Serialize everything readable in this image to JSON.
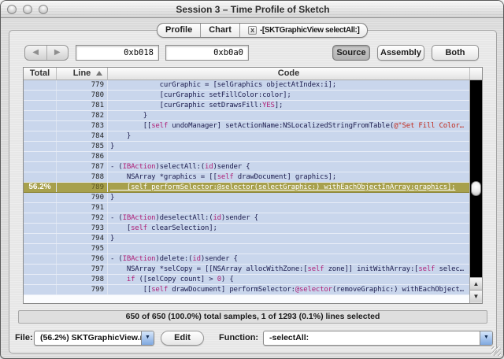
{
  "window": {
    "title": "Session 3 – Time Profile of Sketch"
  },
  "tabs": [
    {
      "label": "Profile"
    },
    {
      "label": "Chart"
    },
    {
      "label": "-[SKTGraphicView selectAll:]",
      "close_icon": "x"
    }
  ],
  "toolbar": {
    "back_icon": "◀",
    "forward_icon": "▶",
    "address1": "0xb018",
    "address2": "0xb0a0",
    "view_buttons": [
      {
        "label": "Source",
        "selected": true
      },
      {
        "label": "Assembly",
        "selected": false
      },
      {
        "label": "Both",
        "selected": false
      }
    ]
  },
  "table": {
    "columns": {
      "total": "Total",
      "line": "Line",
      "code": "Code"
    },
    "sort_column": "Line",
    "rows": [
      {
        "total": "",
        "line": "779",
        "highlight": false,
        "code": [
          {
            "t": "            curGraphic = [selGraphics objectAtIndex:i];",
            "c": "p"
          }
        ]
      },
      {
        "total": "",
        "line": "780",
        "highlight": false,
        "code": [
          {
            "t": "            [curGraphic setFillColor:color];",
            "c": "p"
          }
        ]
      },
      {
        "total": "",
        "line": "781",
        "highlight": false,
        "code": [
          {
            "t": "            [curGraphic setDrawsFill:",
            "c": "p"
          },
          {
            "t": "YES",
            "c": "k"
          },
          {
            "t": "];",
            "c": "p"
          }
        ]
      },
      {
        "total": "",
        "line": "782",
        "highlight": false,
        "code": [
          {
            "t": "        }",
            "c": "p"
          }
        ]
      },
      {
        "total": "",
        "line": "783",
        "highlight": false,
        "code": [
          {
            "t": "        [[",
            "c": "p"
          },
          {
            "t": "self",
            "c": "k"
          },
          {
            "t": " undoManager] setActionName:NSLocalizedStringFromTable(",
            "c": "p"
          },
          {
            "t": "@\"Set Fill Color…",
            "c": "s"
          }
        ]
      },
      {
        "total": "",
        "line": "784",
        "highlight": false,
        "code": [
          {
            "t": "    }",
            "c": "p"
          }
        ]
      },
      {
        "total": "",
        "line": "785",
        "highlight": false,
        "code": [
          {
            "t": "}",
            "c": "p"
          }
        ]
      },
      {
        "total": "",
        "line": "786",
        "highlight": false,
        "code": []
      },
      {
        "total": "",
        "line": "787",
        "highlight": false,
        "code": [
          {
            "t": "- (",
            "c": "p"
          },
          {
            "t": "IBAction",
            "c": "k"
          },
          {
            "t": ")selectAll:(",
            "c": "p"
          },
          {
            "t": "id",
            "c": "k"
          },
          {
            "t": ")sender {",
            "c": "p"
          }
        ]
      },
      {
        "total": "",
        "line": "788",
        "highlight": false,
        "code": [
          {
            "t": "    NSArray *graphics = [[",
            "c": "p"
          },
          {
            "t": "self",
            "c": "k"
          },
          {
            "t": " drawDocument] graphics];",
            "c": "p"
          }
        ]
      },
      {
        "total": "56.2%",
        "line": "789",
        "highlight": true,
        "code": [
          {
            "t": "    [self performSelector:@selector(selectGraphic:) withEachObjectInArray:graphics];",
            "c": "p"
          }
        ]
      },
      {
        "total": "",
        "line": "790",
        "highlight": false,
        "code": [
          {
            "t": "}",
            "c": "p"
          }
        ]
      },
      {
        "total": "",
        "line": "791",
        "highlight": false,
        "code": []
      },
      {
        "total": "",
        "line": "792",
        "highlight": false,
        "code": [
          {
            "t": "- (",
            "c": "p"
          },
          {
            "t": "IBAction",
            "c": "k"
          },
          {
            "t": ")deselectAll:(",
            "c": "p"
          },
          {
            "t": "id",
            "c": "k"
          },
          {
            "t": ")sender {",
            "c": "p"
          }
        ]
      },
      {
        "total": "",
        "line": "793",
        "highlight": false,
        "code": [
          {
            "t": "    [",
            "c": "p"
          },
          {
            "t": "self",
            "c": "k"
          },
          {
            "t": " clearSelection];",
            "c": "p"
          }
        ]
      },
      {
        "total": "",
        "line": "794",
        "highlight": false,
        "code": [
          {
            "t": "}",
            "c": "p"
          }
        ]
      },
      {
        "total": "",
        "line": "795",
        "highlight": false,
        "code": []
      },
      {
        "total": "",
        "line": "796",
        "highlight": false,
        "code": [
          {
            "t": "- (",
            "c": "p"
          },
          {
            "t": "IBAction",
            "c": "k"
          },
          {
            "t": ")delete:(",
            "c": "p"
          },
          {
            "t": "id",
            "c": "k"
          },
          {
            "t": ")sender {",
            "c": "p"
          }
        ]
      },
      {
        "total": "",
        "line": "797",
        "highlight": false,
        "code": [
          {
            "t": "    NSArray *selCopy = [[NSArray allocWithZone:[",
            "c": "p"
          },
          {
            "t": "self",
            "c": "k"
          },
          {
            "t": " zone]] initWithArray:[",
            "c": "p"
          },
          {
            "t": "self",
            "c": "k"
          },
          {
            "t": " selec…",
            "c": "p"
          }
        ]
      },
      {
        "total": "",
        "line": "798",
        "highlight": false,
        "code": [
          {
            "t": "    ",
            "c": "p"
          },
          {
            "t": "if",
            "c": "k"
          },
          {
            "t": " ([selCopy count] > ",
            "c": "p"
          },
          {
            "t": "0",
            "c": "k"
          },
          {
            "t": ") {",
            "c": "p"
          }
        ]
      },
      {
        "total": "",
        "line": "799",
        "highlight": false,
        "code": [
          {
            "t": "        [[",
            "c": "p"
          },
          {
            "t": "self",
            "c": "k"
          },
          {
            "t": " drawDocument] performSelector:",
            "c": "p"
          },
          {
            "t": "@selector",
            "c": "k"
          },
          {
            "t": "(removeGraphic:) withEachObject…",
            "c": "p"
          }
        ]
      }
    ]
  },
  "scrollbar": {
    "up_icon": "▲",
    "down_icon": "▼"
  },
  "status": {
    "text": "650 of 650 (100.0%) total samples, 1 of 1293 (0.1%) lines selected"
  },
  "footer": {
    "file_label": "File:",
    "file_value": "(56.2%) SKTGraphicView.m",
    "edit_label": "Edit",
    "function_label": "Function:",
    "function_value": "-selectAll:",
    "popup_arrow": "▼"
  },
  "colors": {
    "row_blue": "#c9d6ec",
    "highlight_olive": "#a7a04c",
    "keyword_magenta": "#b02178",
    "string_red": "#c22a1c",
    "code_navy": "#1d1d4e",
    "popup_cap_blue": "#7fa8e0"
  }
}
